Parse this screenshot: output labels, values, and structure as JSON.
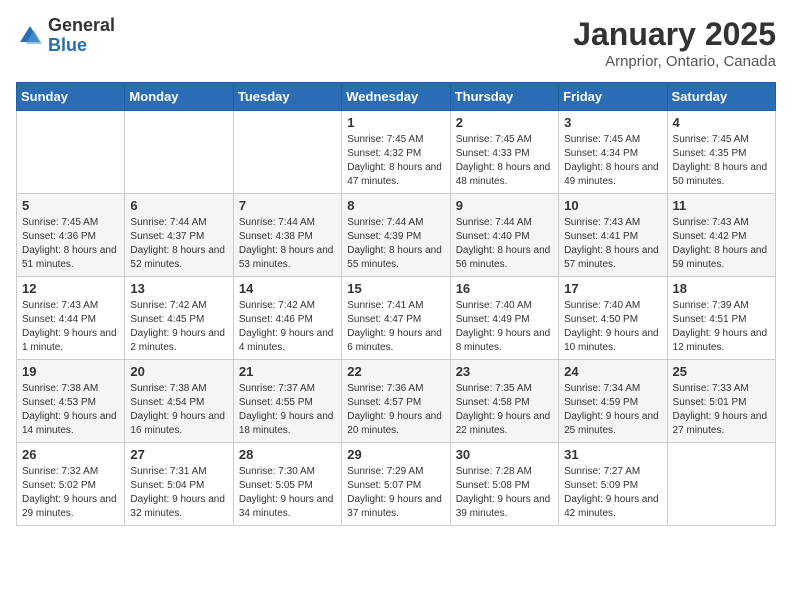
{
  "logo": {
    "general": "General",
    "blue": "Blue"
  },
  "header": {
    "month": "January 2025",
    "location": "Arnprior, Ontario, Canada"
  },
  "weekdays": [
    "Sunday",
    "Monday",
    "Tuesday",
    "Wednesday",
    "Thursday",
    "Friday",
    "Saturday"
  ],
  "weeks": [
    [
      {
        "day": "",
        "info": ""
      },
      {
        "day": "",
        "info": ""
      },
      {
        "day": "",
        "info": ""
      },
      {
        "day": "1",
        "info": "Sunrise: 7:45 AM\nSunset: 4:32 PM\nDaylight: 8 hours and 47 minutes."
      },
      {
        "day": "2",
        "info": "Sunrise: 7:45 AM\nSunset: 4:33 PM\nDaylight: 8 hours and 48 minutes."
      },
      {
        "day": "3",
        "info": "Sunrise: 7:45 AM\nSunset: 4:34 PM\nDaylight: 8 hours and 49 minutes."
      },
      {
        "day": "4",
        "info": "Sunrise: 7:45 AM\nSunset: 4:35 PM\nDaylight: 8 hours and 50 minutes."
      }
    ],
    [
      {
        "day": "5",
        "info": "Sunrise: 7:45 AM\nSunset: 4:36 PM\nDaylight: 8 hours and 51 minutes."
      },
      {
        "day": "6",
        "info": "Sunrise: 7:44 AM\nSunset: 4:37 PM\nDaylight: 8 hours and 52 minutes."
      },
      {
        "day": "7",
        "info": "Sunrise: 7:44 AM\nSunset: 4:38 PM\nDaylight: 8 hours and 53 minutes."
      },
      {
        "day": "8",
        "info": "Sunrise: 7:44 AM\nSunset: 4:39 PM\nDaylight: 8 hours and 55 minutes."
      },
      {
        "day": "9",
        "info": "Sunrise: 7:44 AM\nSunset: 4:40 PM\nDaylight: 8 hours and 56 minutes."
      },
      {
        "day": "10",
        "info": "Sunrise: 7:43 AM\nSunset: 4:41 PM\nDaylight: 8 hours and 57 minutes."
      },
      {
        "day": "11",
        "info": "Sunrise: 7:43 AM\nSunset: 4:42 PM\nDaylight: 8 hours and 59 minutes."
      }
    ],
    [
      {
        "day": "12",
        "info": "Sunrise: 7:43 AM\nSunset: 4:44 PM\nDaylight: 9 hours and 1 minute."
      },
      {
        "day": "13",
        "info": "Sunrise: 7:42 AM\nSunset: 4:45 PM\nDaylight: 9 hours and 2 minutes."
      },
      {
        "day": "14",
        "info": "Sunrise: 7:42 AM\nSunset: 4:46 PM\nDaylight: 9 hours and 4 minutes."
      },
      {
        "day": "15",
        "info": "Sunrise: 7:41 AM\nSunset: 4:47 PM\nDaylight: 9 hours and 6 minutes."
      },
      {
        "day": "16",
        "info": "Sunrise: 7:40 AM\nSunset: 4:49 PM\nDaylight: 9 hours and 8 minutes."
      },
      {
        "day": "17",
        "info": "Sunrise: 7:40 AM\nSunset: 4:50 PM\nDaylight: 9 hours and 10 minutes."
      },
      {
        "day": "18",
        "info": "Sunrise: 7:39 AM\nSunset: 4:51 PM\nDaylight: 9 hours and 12 minutes."
      }
    ],
    [
      {
        "day": "19",
        "info": "Sunrise: 7:38 AM\nSunset: 4:53 PM\nDaylight: 9 hours and 14 minutes."
      },
      {
        "day": "20",
        "info": "Sunrise: 7:38 AM\nSunset: 4:54 PM\nDaylight: 9 hours and 16 minutes."
      },
      {
        "day": "21",
        "info": "Sunrise: 7:37 AM\nSunset: 4:55 PM\nDaylight: 9 hours and 18 minutes."
      },
      {
        "day": "22",
        "info": "Sunrise: 7:36 AM\nSunset: 4:57 PM\nDaylight: 9 hours and 20 minutes."
      },
      {
        "day": "23",
        "info": "Sunrise: 7:35 AM\nSunset: 4:58 PM\nDaylight: 9 hours and 22 minutes."
      },
      {
        "day": "24",
        "info": "Sunrise: 7:34 AM\nSunset: 4:59 PM\nDaylight: 9 hours and 25 minutes."
      },
      {
        "day": "25",
        "info": "Sunrise: 7:33 AM\nSunset: 5:01 PM\nDaylight: 9 hours and 27 minutes."
      }
    ],
    [
      {
        "day": "26",
        "info": "Sunrise: 7:32 AM\nSunset: 5:02 PM\nDaylight: 9 hours and 29 minutes."
      },
      {
        "day": "27",
        "info": "Sunrise: 7:31 AM\nSunset: 5:04 PM\nDaylight: 9 hours and 32 minutes."
      },
      {
        "day": "28",
        "info": "Sunrise: 7:30 AM\nSunset: 5:05 PM\nDaylight: 9 hours and 34 minutes."
      },
      {
        "day": "29",
        "info": "Sunrise: 7:29 AM\nSunset: 5:07 PM\nDaylight: 9 hours and 37 minutes."
      },
      {
        "day": "30",
        "info": "Sunrise: 7:28 AM\nSunset: 5:08 PM\nDaylight: 9 hours and 39 minutes."
      },
      {
        "day": "31",
        "info": "Sunrise: 7:27 AM\nSunset: 5:09 PM\nDaylight: 9 hours and 42 minutes."
      },
      {
        "day": "",
        "info": ""
      }
    ]
  ]
}
